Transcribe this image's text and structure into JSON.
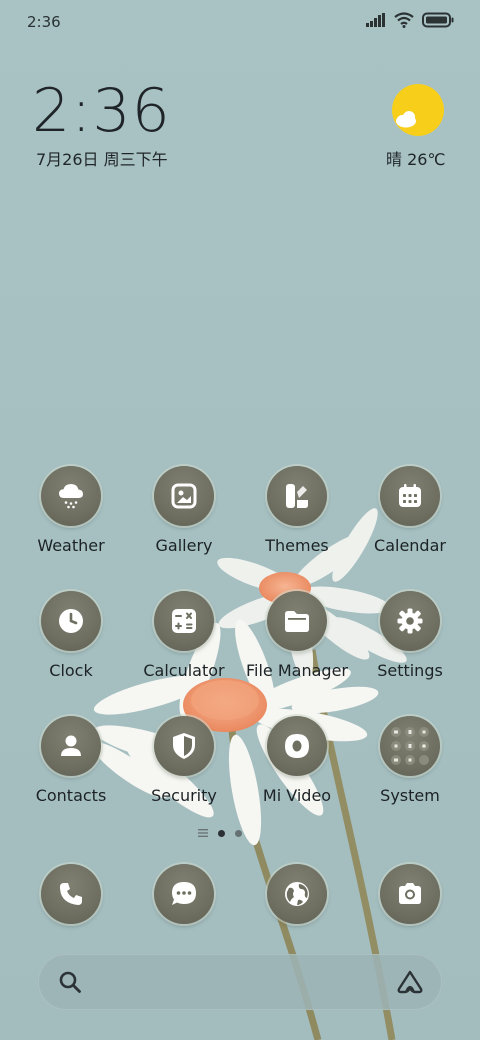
{
  "status_bar": {
    "time": "2:36",
    "icons": [
      "signal-icon",
      "wifi-icon",
      "battery-icon"
    ]
  },
  "clock_widget": {
    "time": "2:36",
    "date": "7月26日 周三下午"
  },
  "weather_widget": {
    "icon": "sun-cloud-icon",
    "text": "晴 26℃"
  },
  "apps": [
    {
      "label": "Weather",
      "icon": "cloud-rain-icon"
    },
    {
      "label": "Gallery",
      "icon": "image-icon"
    },
    {
      "label": "Themes",
      "icon": "palette-icon"
    },
    {
      "label": "Calendar",
      "icon": "calendar-icon"
    },
    {
      "label": "Clock",
      "icon": "clock-icon"
    },
    {
      "label": "Calculator",
      "icon": "calculator-icon"
    },
    {
      "label": "File Manager",
      "icon": "folder-icon"
    },
    {
      "label": "Settings",
      "icon": "gear-icon"
    },
    {
      "label": "Contacts",
      "icon": "person-icon"
    },
    {
      "label": "Security",
      "icon": "shield-icon"
    },
    {
      "label": "Mi Video",
      "icon": "play-icon"
    },
    {
      "label": "System",
      "icon": "folder-grid-icon"
    }
  ],
  "dock": [
    {
      "icon": "phone-icon"
    },
    {
      "icon": "message-icon"
    },
    {
      "icon": "browser-icon"
    },
    {
      "icon": "camera-icon"
    }
  ],
  "pager": {
    "pages": 2,
    "current": 1
  },
  "search_bar": {
    "icons": [
      "search-icon",
      "assistant-icon"
    ]
  },
  "colors": {
    "background": "#a6c0c2",
    "icon_bubble": "#6e6f61",
    "sun": "#f7cf1a",
    "text": "#1f2528"
  }
}
